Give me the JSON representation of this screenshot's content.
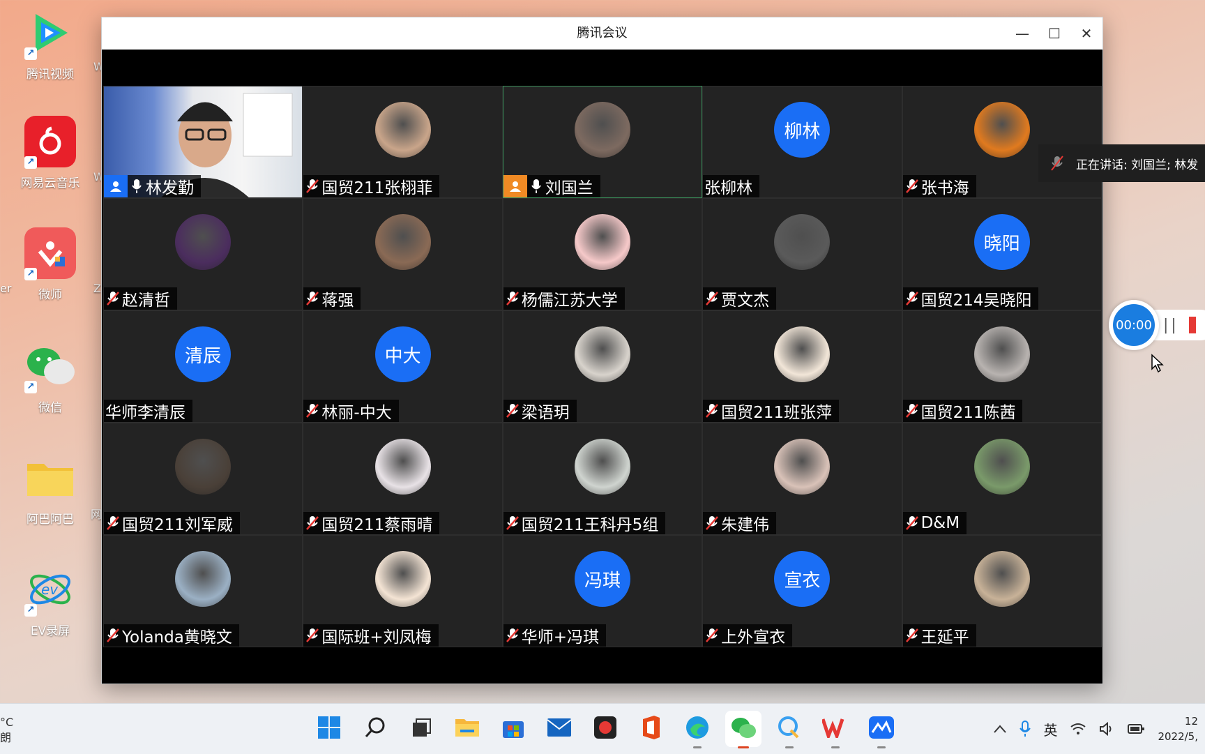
{
  "desktop": {
    "icons": [
      {
        "label": "腾讯视频",
        "icon": "tencent-video-icon"
      },
      {
        "label": "网易云音乐",
        "icon": "netease-music-icon"
      },
      {
        "label": "微师",
        "icon": "weishi-icon"
      },
      {
        "label": "微信",
        "icon": "wechat-icon"
      },
      {
        "label": "阿巴阿巴",
        "icon": "folder-icon"
      },
      {
        "label": "EV录屏",
        "icon": "ev-recorder-icon"
      }
    ],
    "edge_labels": [
      "W",
      "W",
      "Z",
      "网"
    ],
    "left_edge": "er"
  },
  "window": {
    "title": "腾讯会议",
    "minimize": "—",
    "maximize": "☐",
    "close": "✕"
  },
  "speaking_banner": "正在讲话: 刘国兰; 林发",
  "recording": {
    "time": "00:00",
    "pause": "||"
  },
  "participants": [
    {
      "name": "林发勤",
      "mic": "on",
      "badge": "host",
      "avatar_type": "video"
    },
    {
      "name": "国贸211张栩菲",
      "mic": "muted",
      "avatar_type": "photo",
      "avatar_color": "#c9a58a"
    },
    {
      "name": "刘国兰",
      "mic": "on",
      "badge": "cohost",
      "avatar_type": "photo",
      "avatar_color": "#7d6a60"
    },
    {
      "name": "张柳林",
      "mic": "none",
      "avatar_type": "text",
      "avatar_text": "柳林"
    },
    {
      "name": "张书海",
      "mic": "muted",
      "avatar_type": "photo",
      "avatar_color": "#e07a1f"
    },
    {
      "name": "赵清哲",
      "mic": "muted",
      "avatar_type": "photo",
      "avatar_color": "#4b2d5e"
    },
    {
      "name": "蒋强",
      "mic": "muted",
      "avatar_type": "photo",
      "avatar_color": "#8a6a55"
    },
    {
      "name": "杨儒江苏大学",
      "mic": "muted",
      "avatar_type": "photo",
      "avatar_color": "#f6c9c9"
    },
    {
      "name": "贾文杰",
      "mic": "muted",
      "avatar_type": "photo",
      "avatar_color": "#5a5a5a"
    },
    {
      "name": "国贸214吴晓阳",
      "mic": "muted",
      "avatar_type": "text",
      "avatar_text": "晓阳"
    },
    {
      "name": "华师李清辰",
      "mic": "none",
      "avatar_type": "text",
      "avatar_text": "清辰"
    },
    {
      "name": "林丽-中大",
      "mic": "muted",
      "avatar_type": "text",
      "avatar_text": "中大"
    },
    {
      "name": "梁语玥",
      "mic": "muted",
      "avatar_type": "photo",
      "avatar_color": "#d8d3cc"
    },
    {
      "name": "国贸211班张萍",
      "mic": "muted",
      "avatar_type": "photo",
      "avatar_color": "#f2e6d8"
    },
    {
      "name": "国贸211陈茜",
      "mic": "muted",
      "avatar_type": "photo",
      "avatar_color": "#b8b3b0"
    },
    {
      "name": "国贸211刘军威",
      "mic": "muted",
      "avatar_type": "photo",
      "avatar_color": "#4a4038"
    },
    {
      "name": "国贸211蔡雨晴",
      "mic": "muted",
      "avatar_type": "photo",
      "avatar_color": "#e8e2e6"
    },
    {
      "name": "国贸211王科丹5组",
      "mic": "muted",
      "avatar_type": "photo",
      "avatar_color": "#cfd4cf"
    },
    {
      "name": "朱建伟",
      "mic": "muted",
      "avatar_type": "photo",
      "avatar_color": "#d9c2b8"
    },
    {
      "name": "D&M",
      "mic": "muted",
      "avatar_type": "photo",
      "avatar_color": "#7a9a6a"
    },
    {
      "name": "Yolanda黄晓文",
      "mic": "muted",
      "avatar_type": "photo",
      "avatar_color": "#9bb0c4"
    },
    {
      "name": "国际班+刘凤梅",
      "mic": "muted",
      "avatar_type": "photo",
      "avatar_color": "#f4e4d4"
    },
    {
      "name": "华师+冯琪",
      "mic": "muted",
      "avatar_type": "text",
      "avatar_text": "冯琪"
    },
    {
      "name": "上外宣衣",
      "mic": "muted",
      "avatar_type": "text",
      "avatar_text": "宣衣"
    },
    {
      "name": "王延平",
      "mic": "muted",
      "avatar_type": "photo",
      "avatar_color": "#c8b298"
    }
  ],
  "taskbar": {
    "apps": [
      {
        "name": "start-icon",
        "color": "#1e88e5"
      },
      {
        "name": "search-icon",
        "color": "#222"
      },
      {
        "name": "task-view-icon",
        "color": "#333"
      },
      {
        "name": "file-explorer-icon",
        "color": "#f6b73c"
      },
      {
        "name": "store-icon",
        "color": "#2b6fd6"
      },
      {
        "name": "mail-icon",
        "color": "#1565c0"
      },
      {
        "name": "camera-icon",
        "color": "#e53935"
      },
      {
        "name": "office-icon",
        "color": "#e64a19"
      },
      {
        "name": "edge-icon",
        "color": "#1e9be0"
      },
      {
        "name": "wechat-icon",
        "color": "#2bb24c"
      },
      {
        "name": "qq-icon",
        "color": "#3aa0f0"
      },
      {
        "name": "wps-icon",
        "color": "#e53935"
      },
      {
        "name": "tencent-meeting-icon",
        "color": "#1a6ef5"
      }
    ],
    "ime": "英",
    "clock_time": "12",
    "clock_date": "2022/5,",
    "weather_temp": "°C",
    "weather_desc": "朗"
  }
}
